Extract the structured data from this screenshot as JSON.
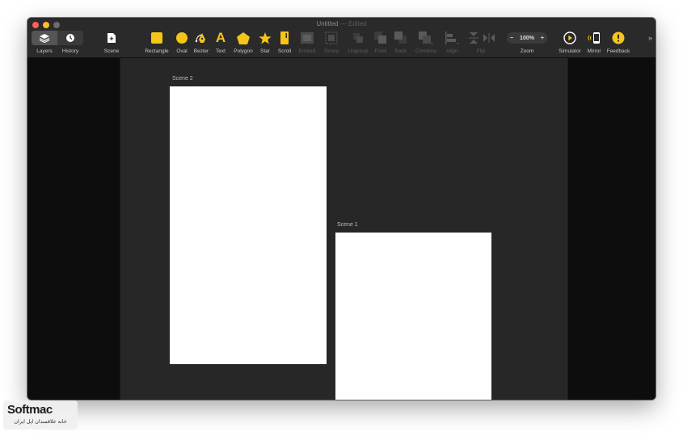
{
  "window": {
    "title": "Untitled",
    "title_separator": " — ",
    "title_status": "Edited"
  },
  "toolbar": {
    "layers": "Layers",
    "history": "History",
    "scene": "Scene",
    "rectangle": "Rectangle",
    "oval": "Oval",
    "bezier": "Bezier",
    "text": "Text",
    "text_glyph": "A",
    "polygon": "Polygon",
    "star": "Star",
    "scroll": "Scroll",
    "embed": "Embed",
    "group": "Group",
    "ungroup": "Ungroup",
    "front": "Front",
    "back": "Back",
    "combine": "Combine",
    "align": "Align",
    "flip": "Flip",
    "zoom_minus": "−",
    "zoom_value": "100%",
    "zoom_plus": "+",
    "zoom": "Zoom",
    "simulator": "Simulator",
    "mirror": "Mirror",
    "feedback": "Feedback",
    "overflow": "»"
  },
  "canvas": {
    "scenes": [
      {
        "label": "Scene 2"
      },
      {
        "label": "Scene 1"
      }
    ]
  },
  "watermark": {
    "logo": "Softmac",
    "subtitle": "خانه علاقمندان اپل ایران"
  },
  "colors": {
    "accent": "#f5c518",
    "canvas": "#272727",
    "panel": "#0d0d0d",
    "toolbar": "#2a2a2a"
  }
}
